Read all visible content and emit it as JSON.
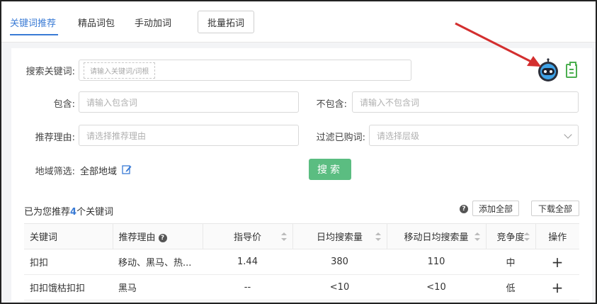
{
  "tabs": [
    {
      "label": "关键词推荐",
      "active": true
    },
    {
      "label": "精品词包",
      "active": false
    },
    {
      "label": "手动加词",
      "active": false
    }
  ],
  "batch_button": "批量拓词",
  "form": {
    "keyword_label": "搜索关键词:",
    "keyword_placeholder": "请输入关键词/词根",
    "include_label": "包含:",
    "include_placeholder": "请输入包含词",
    "exclude_label": "不包含:",
    "exclude_placeholder": "请输入不包含词",
    "reason_label": "推荐理由:",
    "reason_placeholder": "请选择推荐理由",
    "filter_label": "过滤已购词:",
    "filter_placeholder": "请选择层级",
    "region_label": "地域筛选:",
    "region_value": "全部地域",
    "search_button": "搜索"
  },
  "result": {
    "prefix": "已为您推荐",
    "count": "4",
    "suffix": "个关键词",
    "add_all": "添加全部",
    "download_all": "下载全部"
  },
  "table": {
    "headers": [
      "关键词",
      "推荐理由",
      "指导价",
      "日均搜索量",
      "移动日均搜索量",
      "竞争度",
      "操作"
    ],
    "rows": [
      {
        "keyword": "扣扣",
        "reason": "移动、黑马、热...",
        "price": "1.44",
        "daily": "380",
        "mobile": "110",
        "competition": "中",
        "action": "+"
      },
      {
        "keyword": "扣扣饿枯扣扣",
        "reason": "黑马",
        "price": "--",
        "daily": "<10",
        "mobile": "<10",
        "competition": "低",
        "action": "+"
      }
    ]
  },
  "colors": {
    "accent": "#3a7bd5",
    "search_button": "#5bbd81",
    "arrow": "#d32f2f"
  }
}
